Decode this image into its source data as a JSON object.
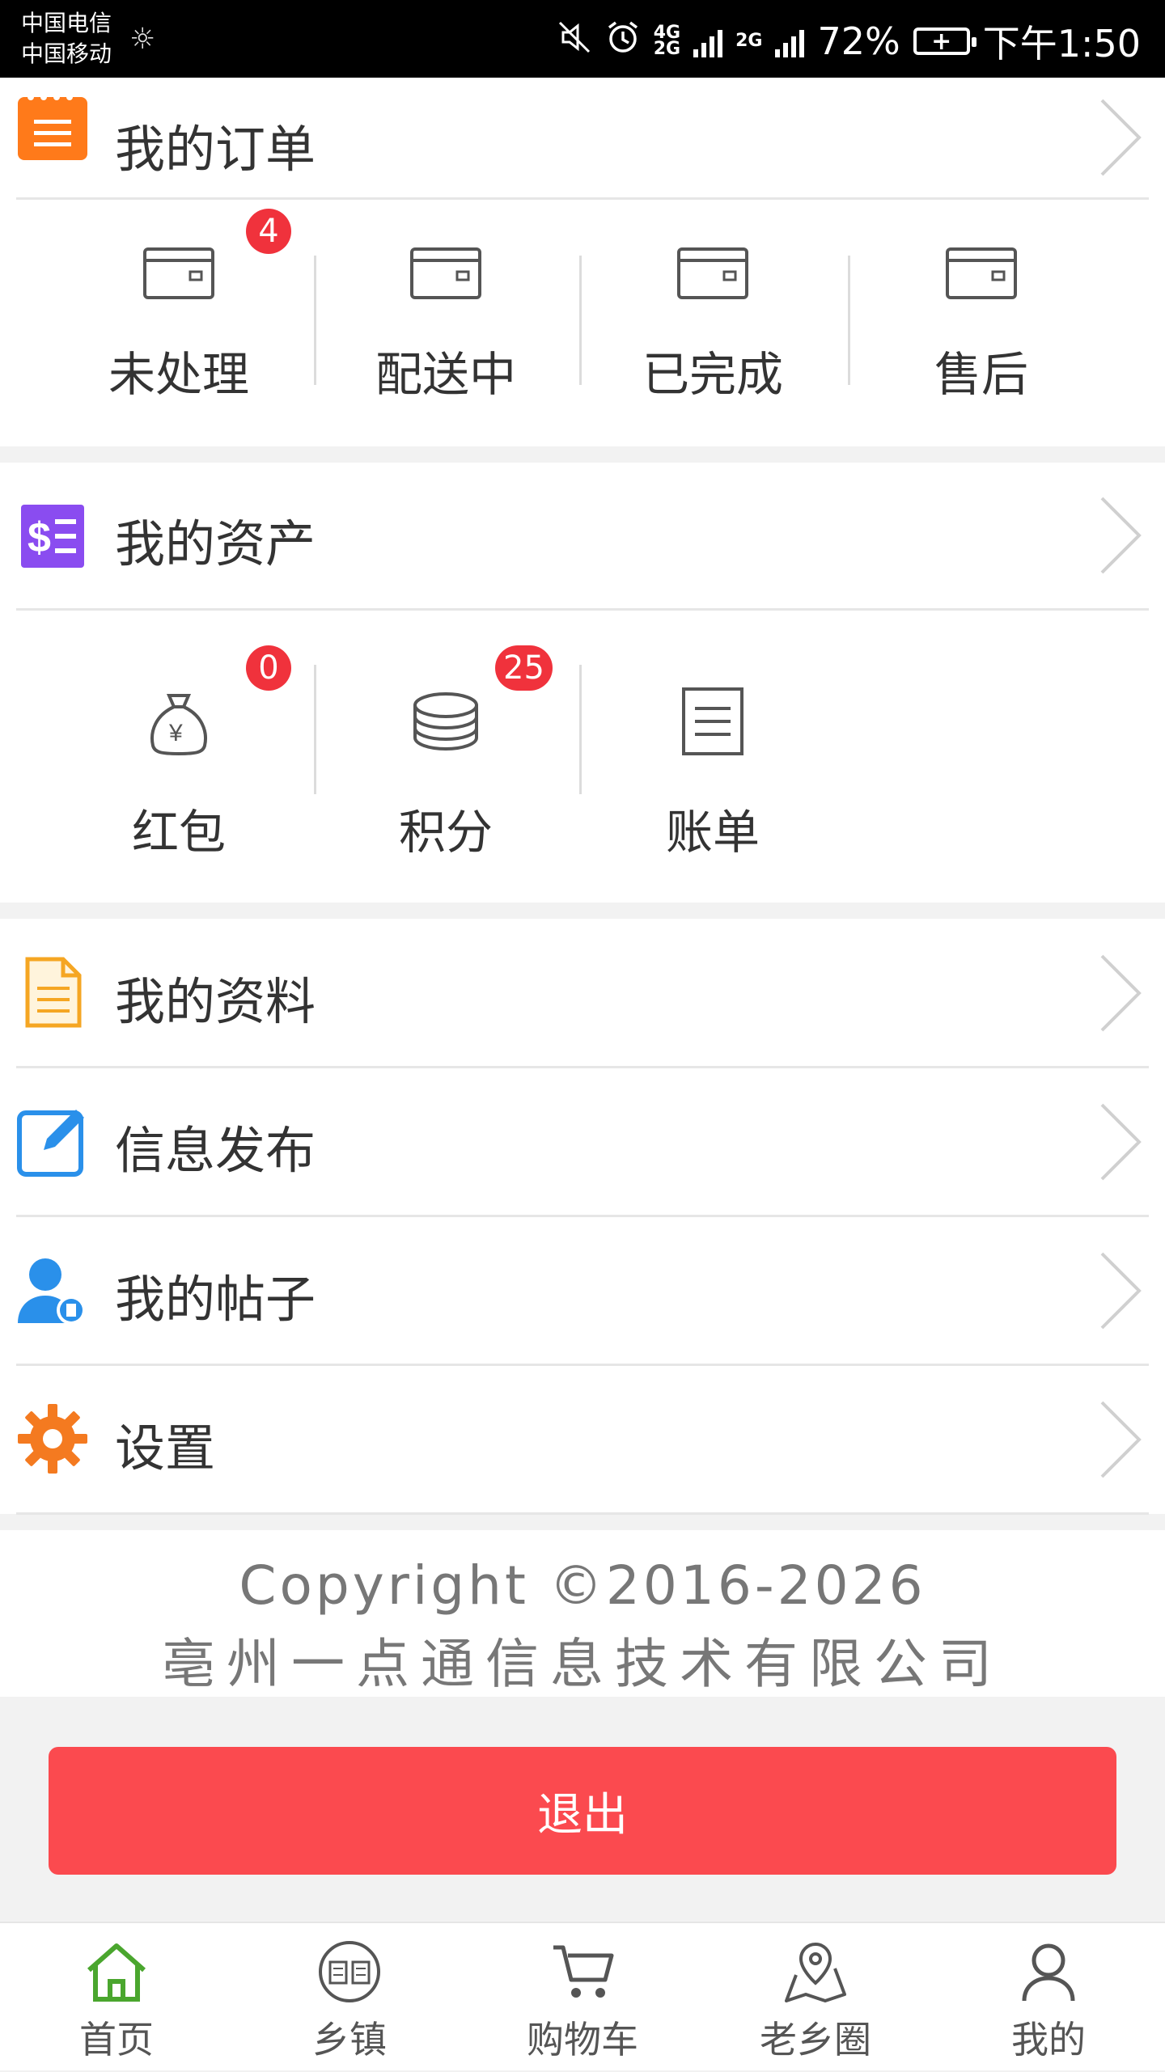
{
  "status_bar": {
    "carrier1": "中国电信",
    "carrier2": "中国移动",
    "net1": "4G",
    "net2": "2G",
    "net3": "2G",
    "battery": "72%",
    "time": "下午1:50"
  },
  "orders": {
    "title": "我的订单",
    "items": [
      {
        "label": "未处理",
        "badge": "4"
      },
      {
        "label": "配送中",
        "badge": ""
      },
      {
        "label": "已完成",
        "badge": ""
      },
      {
        "label": "售后",
        "badge": ""
      }
    ]
  },
  "assets": {
    "title": "我的资产",
    "items": [
      {
        "label": "红包",
        "badge": "0"
      },
      {
        "label": "积分",
        "badge": "25"
      },
      {
        "label": "账单",
        "badge": ""
      }
    ]
  },
  "menu": [
    {
      "label": "我的资料",
      "icon": "document-icon"
    },
    {
      "label": "信息发布",
      "icon": "edit-icon"
    },
    {
      "label": "我的帖子",
      "icon": "user-post-icon"
    },
    {
      "label": "设置",
      "icon": "gear-icon"
    }
  ],
  "copyright": {
    "line1": "Copyright ©2016-2026",
    "line2": "亳州一点通信息技术有限公司"
  },
  "logout_label": "退出",
  "tabs": [
    {
      "label": "首页",
      "icon": "home-icon"
    },
    {
      "label": "乡镇",
      "icon": "book-icon"
    },
    {
      "label": "购物车",
      "icon": "cart-icon"
    },
    {
      "label": "老乡圈",
      "icon": "map-icon"
    },
    {
      "label": "我的",
      "icon": "person-icon"
    }
  ],
  "colors": {
    "accent_orange": "#ff7a1a",
    "badge_red": "#f0323c",
    "logout_red": "#fb4a4f",
    "purple": "#8a4cf0",
    "blue": "#2a90ea",
    "home_green": "#4aa62e"
  }
}
